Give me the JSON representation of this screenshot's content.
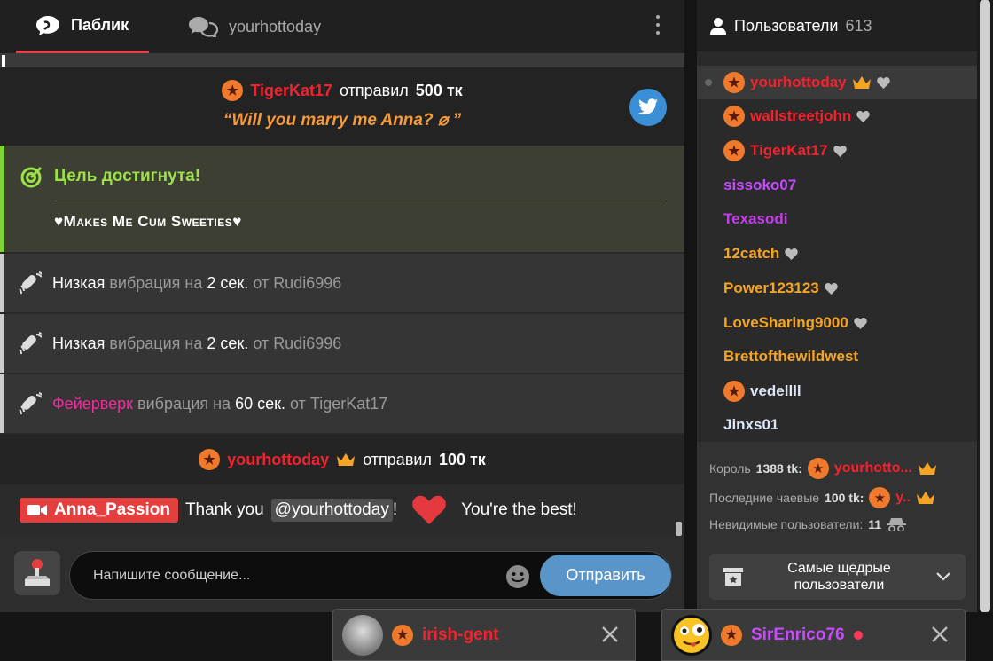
{
  "tabs": {
    "public": "Паблик",
    "private": "yourhottoday"
  },
  "tip1": {
    "user": "TigerKat17",
    "verb": "отправил",
    "amount": "500 тк",
    "quote": "“Will you marry me Anna? ⌀ ”"
  },
  "goal": {
    "title": "Цель достигнута!",
    "text": "♥Makes Me Cum Sweeties♥"
  },
  "vibrations": [
    {
      "level": "Низкая",
      "word": "вибрация на",
      "dur": "2 сек.",
      "from": "от",
      "user": "Rudi6996"
    },
    {
      "level": "Низкая",
      "word": "вибрация на",
      "dur": "2 сек.",
      "from": "от",
      "user": "Rudi6996"
    },
    {
      "level": "Фейерверк",
      "word": "вибрация на",
      "dur": "60 сек.",
      "from": "от",
      "user": "TigerKat17"
    }
  ],
  "tip2": {
    "user": "yourhottoday",
    "verb": "отправил",
    "amount": "100 тк"
  },
  "host_msg": {
    "host": "Anna_Passion",
    "pre": "Thank you",
    "mention": "@yourhottoday",
    "mid": "!",
    "post": "You're the best!"
  },
  "composer": {
    "placeholder": "Напишите сообщение...",
    "send": "Отправить"
  },
  "users": {
    "title": "Пользователи",
    "count": "613",
    "list": [
      {
        "name": "yourhottoday"
      },
      {
        "name": "wallstreetjohn"
      },
      {
        "name": "TigerKat17"
      },
      {
        "name": "sissoko07"
      },
      {
        "name": "Texasodi"
      },
      {
        "name": "12catch"
      },
      {
        "name": "Power123123"
      },
      {
        "name": "LoveSharing9000"
      },
      {
        "name": "Brettofthewildwest"
      },
      {
        "name": "vedellll"
      },
      {
        "name": "Jinxs01"
      }
    ],
    "king_label": "Король",
    "king_amount": "1388 tk:",
    "king_user": "yourhotto...",
    "last_label": "Последние чаевые",
    "last_amount": "100 tk:",
    "last_user": "y..",
    "invisible_label": "Невидимые пользователи:",
    "invisible_count": "11",
    "generous": "Самые щедрые пользователи"
  },
  "popups": [
    {
      "user": "irish-gent"
    },
    {
      "user": "SirEnrico76"
    }
  ],
  "colors": {
    "accent": "#e2414b",
    "goal": "#7dd33a",
    "send": "#5a95c9",
    "red_user": "#f2232e",
    "orange_user": "#f5a525",
    "purple_user": "#c84bff"
  }
}
